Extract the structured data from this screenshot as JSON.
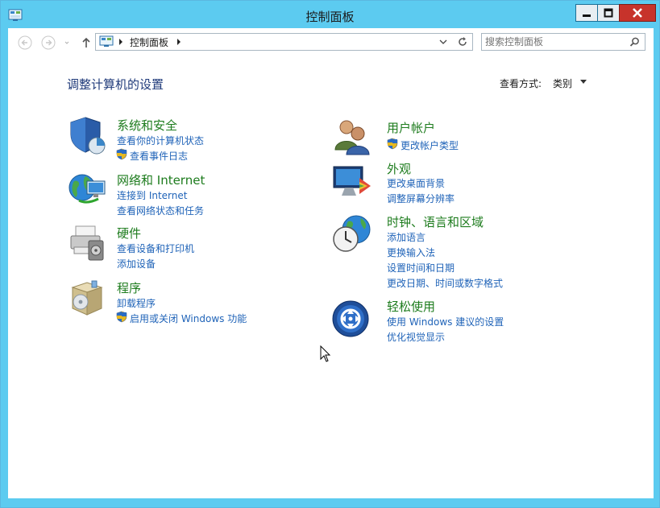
{
  "window": {
    "title": "控制面板"
  },
  "address": {
    "crumb": "控制面板"
  },
  "search": {
    "placeholder": "搜索控制面板"
  },
  "heading": "调整计算机的设置",
  "view_by": {
    "label": "查看方式:",
    "value": "类别"
  },
  "categories": {
    "system": {
      "title": "系统和安全",
      "links": [
        "查看你的计算机状态",
        "查看事件日志"
      ]
    },
    "network": {
      "title": "网络和 Internet",
      "links": [
        "连接到 Internet",
        "查看网络状态和任务"
      ]
    },
    "hardware": {
      "title": "硬件",
      "links": [
        "查看设备和打印机",
        "添加设备"
      ]
    },
    "programs": {
      "title": "程序",
      "links": [
        "卸载程序",
        "启用或关闭 Windows 功能"
      ]
    },
    "users": {
      "title": "用户帐户",
      "links": [
        "更改帐户类型"
      ]
    },
    "appearance": {
      "title": "外观",
      "links": [
        "更改桌面背景",
        "调整屏幕分辨率"
      ]
    },
    "clock": {
      "title": "时钟、语言和区域",
      "links": [
        "添加语言",
        "更换输入法",
        "设置时间和日期",
        "更改日期、时间或数字格式"
      ]
    },
    "ease": {
      "title": "轻松使用",
      "links": [
        "使用 Windows 建议的设置",
        "优化视觉显示"
      ]
    }
  }
}
